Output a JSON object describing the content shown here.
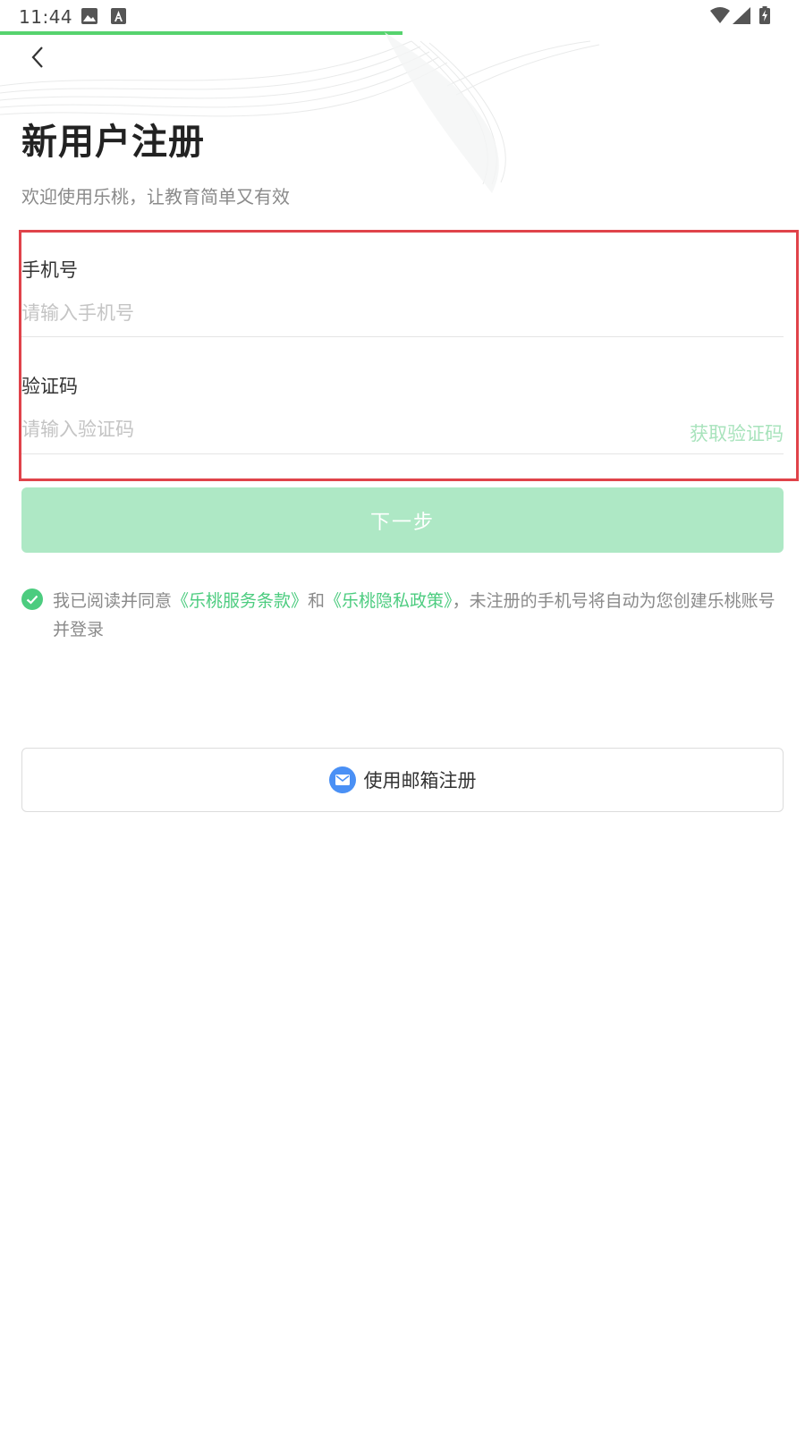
{
  "status_bar": {
    "time": "11:44",
    "icons": [
      "image-icon",
      "a-badge-icon",
      "wifi-icon",
      "signal-icon",
      "battery-charging-icon"
    ]
  },
  "header": {
    "title": "新用户注册",
    "subtitle": "欢迎使用乐桃，让教育简单又有效"
  },
  "form": {
    "phone_label": "手机号",
    "phone_placeholder": "请输入手机号",
    "code_label": "验证码",
    "code_placeholder": "请输入验证码",
    "get_code": "获取验证码"
  },
  "next_button": "下一步",
  "agreement": {
    "prefix": "我已阅读并同意",
    "terms_link": "《乐桃服务条款》",
    "and": "和",
    "privacy_link": "《乐桃隐私政策》",
    "suffix": "，未注册的手机号将自动为您创建乐桃账号并登录",
    "checked": true
  },
  "email_register": {
    "label": "使用邮箱注册",
    "icon": "mail-icon"
  },
  "colors": {
    "accent": "#4ccc7f",
    "button_disabled": "#aee8c5",
    "highlight_border": "#e0434a",
    "mail_blue": "#4a90f5"
  }
}
